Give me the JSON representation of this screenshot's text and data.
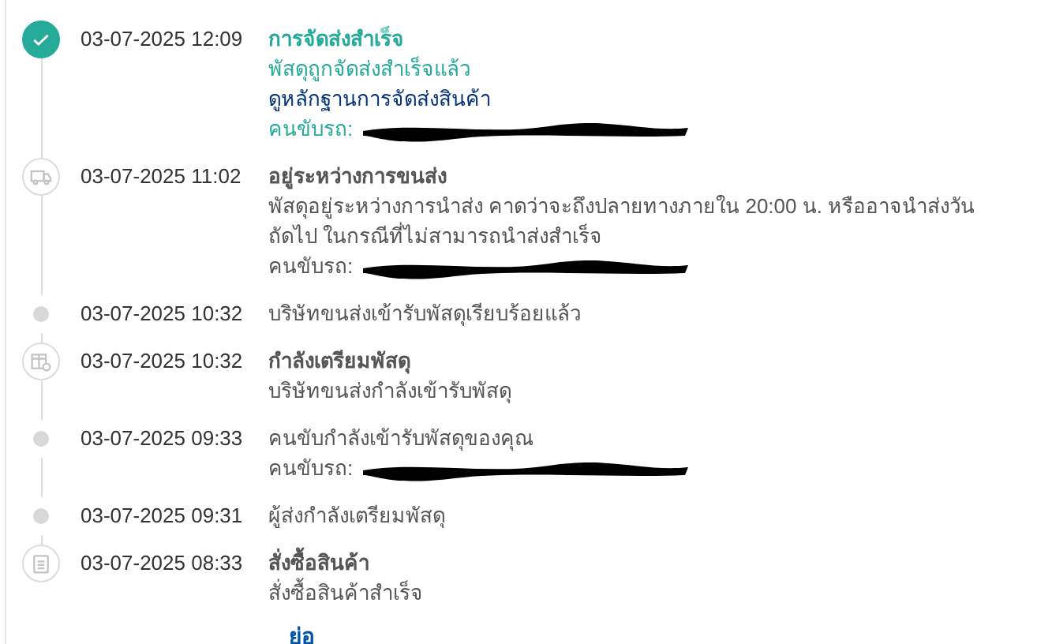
{
  "events": [
    {
      "time": "03-07-2025 12:09",
      "kind": "check",
      "active": true,
      "title": "การจัดส่งสำเร็จ",
      "lines": [
        "พัสดุถูกจัดส่งสำเร็จแล้ว"
      ],
      "link": "ดูหลักฐานการจัดส่งสินค้า",
      "driver": "คนขับรถ:"
    },
    {
      "time": "03-07-2025 11:02",
      "kind": "truck",
      "active": false,
      "title": "อยู่ระหว่างการขนส่ง",
      "lines": [
        "พัสดุอยู่ระหว่างการนำส่ง คาดว่าจะถึงปลายทางภายใน 20:00 น. หรืออาจนำส่งวันถัดไป ในกรณีที่ไม่สามารถนำส่งสำเร็จ"
      ],
      "driver": "คนขับรถ:"
    },
    {
      "time": "03-07-2025 10:32",
      "kind": "dot",
      "active": false,
      "lines": [
        "บริษัทขนส่งเข้ารับพัสดุเรียบร้อยแล้ว"
      ]
    },
    {
      "time": "03-07-2025 10:32",
      "kind": "box",
      "active": false,
      "title": "กำลังเตรียมพัสดุ",
      "lines": [
        "บริษัทขนส่งกำลังเข้ารับพัสดุ"
      ]
    },
    {
      "time": "03-07-2025 09:33",
      "kind": "dot",
      "active": false,
      "lines": [
        "คนขับกำลังเข้ารับพัสดุของคุณ"
      ],
      "driver": "คนขับรถ:"
    },
    {
      "time": "03-07-2025 09:31",
      "kind": "dot",
      "active": false,
      "lines": [
        "ผู้ส่งกำลังเตรียมพัสดุ"
      ]
    },
    {
      "time": "03-07-2025 08:33",
      "kind": "clipboard",
      "active": false,
      "title": "สั่งซื้อสินค้า",
      "lines": [
        "สั่งซื้อสินค้าสำเร็จ"
      ]
    }
  ],
  "collapse_link": "ย่อ"
}
